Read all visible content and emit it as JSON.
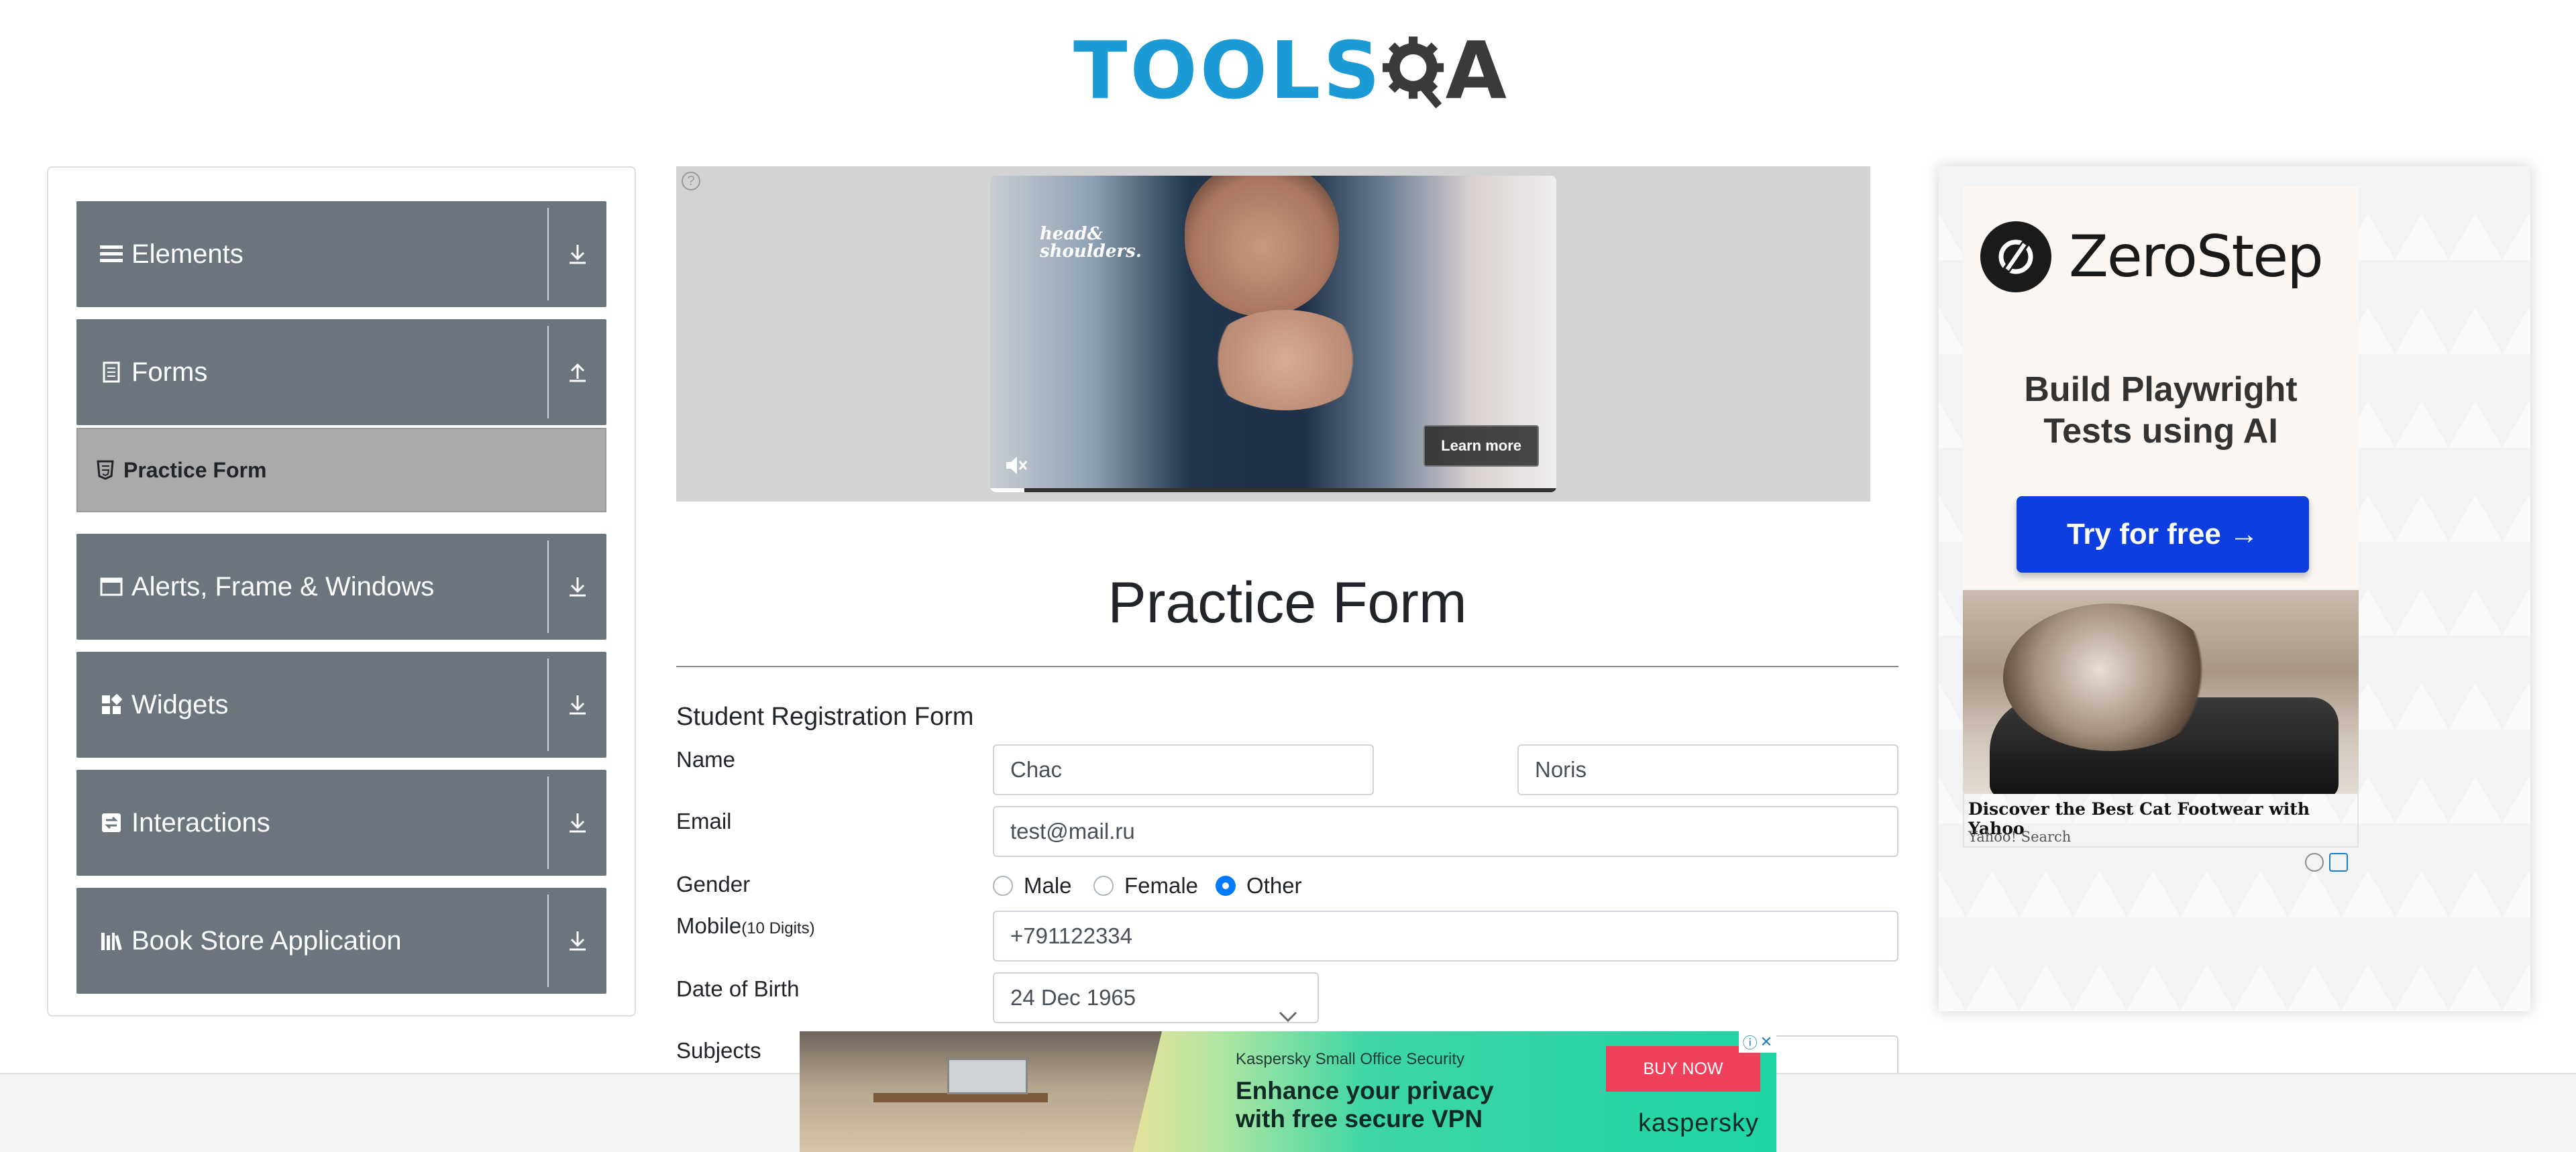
{
  "header": {
    "logo_tools": "TOOLS",
    "logo_qa": "QA"
  },
  "sidebar": {
    "groups": [
      {
        "label": "Elements",
        "icon": "hamburger-icon",
        "arrow": "download-arrow-icon"
      },
      {
        "label": "Forms",
        "icon": "document-icon",
        "arrow": "upload-arrow-icon"
      },
      {
        "label": "Alerts, Frame & Windows",
        "icon": "window-icon",
        "arrow": "download-arrow-icon"
      },
      {
        "label": "Widgets",
        "icon": "widgets-icon",
        "arrow": "download-arrow-icon"
      },
      {
        "label": "Interactions",
        "icon": "interactions-icon",
        "arrow": "download-arrow-icon"
      },
      {
        "label": "Book Store Application",
        "icon": "books-icon",
        "arrow": "download-arrow-icon"
      }
    ],
    "active_item": {
      "label": "Practice Form",
      "icon": "html5-icon"
    }
  },
  "top_ad": {
    "brand": "head&\nshoulders.",
    "button": "Learn more",
    "progress_fraction": 0.06
  },
  "form": {
    "page_title": "Practice Form",
    "section_title": "Student Registration Form",
    "name_label": "Name",
    "first_name": "Chac",
    "last_name": "Noris",
    "email_label": "Email",
    "email": "test@mail.ru",
    "gender_label": "Gender",
    "gender_options": [
      "Male",
      "Female",
      "Other"
    ],
    "gender_selected": "Other",
    "mobile_label": "Mobile",
    "mobile_hint": "(10 Digits)",
    "mobile": "+791122334",
    "dob_label": "Date of Birth",
    "dob": "24 Dec 1965",
    "subjects_label": "Subjects"
  },
  "right_ad": {
    "brand": "ZeroStep",
    "tagline": "Build Playwright\nTests using AI",
    "cta": "Try for free →",
    "cat_title": "Discover the Best Cat Footwear with Yahoo",
    "cat_source": "Yahoo! Search"
  },
  "bottom_ad": {
    "product": "Kaspersky Small Office Security",
    "headline": "Enhance your privacy\nwith free secure VPN",
    "button": "BUY NOW",
    "brand": "kaspersky"
  },
  "colors": {
    "sidebar_group": "#6c757d",
    "active_item": "#aaaaaa",
    "accent": "#007bff",
    "zerostep_button": "#0d3ee0",
    "kaspersky_buy": "#ef3f5b"
  }
}
